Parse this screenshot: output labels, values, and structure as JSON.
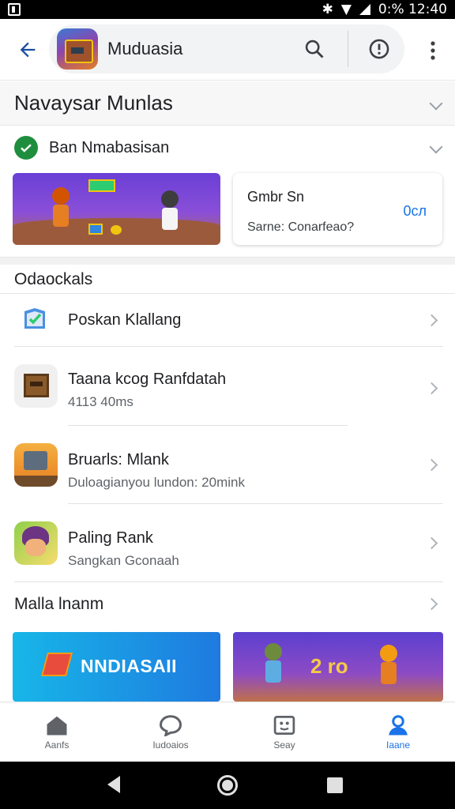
{
  "status_bar": {
    "right_text": "0:% 12:40"
  },
  "app_bar": {
    "title": "Muduasia"
  },
  "section_header": {
    "title": "Navaysar Munlas"
  },
  "ban_row": {
    "label": "Ban Nmabasisan"
  },
  "promo_card": {
    "title": "Gmbr Sn",
    "subtitle": "Sarne: Conarfeao?",
    "count": "0сл"
  },
  "section2": {
    "title": "Odaockals"
  },
  "rows": [
    {
      "title": "Poskan Klallang"
    },
    {
      "title": "Taana kcog Ranfdatah",
      "subtitle": "4113 40ms"
    },
    {
      "title": "Bruarls: Mlank",
      "subtitle": "Duloagianyou lundon: 20mink"
    },
    {
      "title": "Paling Rank",
      "subtitle": "Sangkan Gconaah"
    }
  ],
  "section3": {
    "title": "Malla lnanm"
  },
  "banners": {
    "left_text": "NNDIASAII",
    "right_text": "2 ro"
  },
  "bottom_nav": [
    {
      "label": "Aanfs",
      "icon": "home-icon"
    },
    {
      "label": "Iudoaios",
      "icon": "chat-icon"
    },
    {
      "label": "Seay",
      "icon": "games-icon"
    },
    {
      "label": "Iaane",
      "icon": "profile-icon",
      "active": true
    }
  ],
  "colors": {
    "accent": "#1a73e8",
    "check": "#1e8e3e"
  }
}
